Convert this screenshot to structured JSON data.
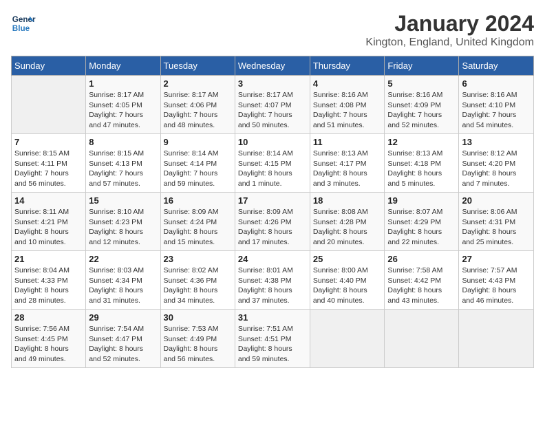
{
  "header": {
    "logo_line1": "General",
    "logo_line2": "Blue",
    "title": "January 2024",
    "subtitle": "Kington, England, United Kingdom"
  },
  "days_of_week": [
    "Sunday",
    "Monday",
    "Tuesday",
    "Wednesday",
    "Thursday",
    "Friday",
    "Saturday"
  ],
  "weeks": [
    [
      {
        "day": "",
        "info": ""
      },
      {
        "day": "1",
        "info": "Sunrise: 8:17 AM\nSunset: 4:05 PM\nDaylight: 7 hours\nand 47 minutes."
      },
      {
        "day": "2",
        "info": "Sunrise: 8:17 AM\nSunset: 4:06 PM\nDaylight: 7 hours\nand 48 minutes."
      },
      {
        "day": "3",
        "info": "Sunrise: 8:17 AM\nSunset: 4:07 PM\nDaylight: 7 hours\nand 50 minutes."
      },
      {
        "day": "4",
        "info": "Sunrise: 8:16 AM\nSunset: 4:08 PM\nDaylight: 7 hours\nand 51 minutes."
      },
      {
        "day": "5",
        "info": "Sunrise: 8:16 AM\nSunset: 4:09 PM\nDaylight: 7 hours\nand 52 minutes."
      },
      {
        "day": "6",
        "info": "Sunrise: 8:16 AM\nSunset: 4:10 PM\nDaylight: 7 hours\nand 54 minutes."
      }
    ],
    [
      {
        "day": "7",
        "info": "Sunrise: 8:15 AM\nSunset: 4:11 PM\nDaylight: 7 hours\nand 56 minutes."
      },
      {
        "day": "8",
        "info": "Sunrise: 8:15 AM\nSunset: 4:13 PM\nDaylight: 7 hours\nand 57 minutes."
      },
      {
        "day": "9",
        "info": "Sunrise: 8:14 AM\nSunset: 4:14 PM\nDaylight: 7 hours\nand 59 minutes."
      },
      {
        "day": "10",
        "info": "Sunrise: 8:14 AM\nSunset: 4:15 PM\nDaylight: 8 hours\nand 1 minute."
      },
      {
        "day": "11",
        "info": "Sunrise: 8:13 AM\nSunset: 4:17 PM\nDaylight: 8 hours\nand 3 minutes."
      },
      {
        "day": "12",
        "info": "Sunrise: 8:13 AM\nSunset: 4:18 PM\nDaylight: 8 hours\nand 5 minutes."
      },
      {
        "day": "13",
        "info": "Sunrise: 8:12 AM\nSunset: 4:20 PM\nDaylight: 8 hours\nand 7 minutes."
      }
    ],
    [
      {
        "day": "14",
        "info": "Sunrise: 8:11 AM\nSunset: 4:21 PM\nDaylight: 8 hours\nand 10 minutes."
      },
      {
        "day": "15",
        "info": "Sunrise: 8:10 AM\nSunset: 4:23 PM\nDaylight: 8 hours\nand 12 minutes."
      },
      {
        "day": "16",
        "info": "Sunrise: 8:09 AM\nSunset: 4:24 PM\nDaylight: 8 hours\nand 15 minutes."
      },
      {
        "day": "17",
        "info": "Sunrise: 8:09 AM\nSunset: 4:26 PM\nDaylight: 8 hours\nand 17 minutes."
      },
      {
        "day": "18",
        "info": "Sunrise: 8:08 AM\nSunset: 4:28 PM\nDaylight: 8 hours\nand 20 minutes."
      },
      {
        "day": "19",
        "info": "Sunrise: 8:07 AM\nSunset: 4:29 PM\nDaylight: 8 hours\nand 22 minutes."
      },
      {
        "day": "20",
        "info": "Sunrise: 8:06 AM\nSunset: 4:31 PM\nDaylight: 8 hours\nand 25 minutes."
      }
    ],
    [
      {
        "day": "21",
        "info": "Sunrise: 8:04 AM\nSunset: 4:33 PM\nDaylight: 8 hours\nand 28 minutes."
      },
      {
        "day": "22",
        "info": "Sunrise: 8:03 AM\nSunset: 4:34 PM\nDaylight: 8 hours\nand 31 minutes."
      },
      {
        "day": "23",
        "info": "Sunrise: 8:02 AM\nSunset: 4:36 PM\nDaylight: 8 hours\nand 34 minutes."
      },
      {
        "day": "24",
        "info": "Sunrise: 8:01 AM\nSunset: 4:38 PM\nDaylight: 8 hours\nand 37 minutes."
      },
      {
        "day": "25",
        "info": "Sunrise: 8:00 AM\nSunset: 4:40 PM\nDaylight: 8 hours\nand 40 minutes."
      },
      {
        "day": "26",
        "info": "Sunrise: 7:58 AM\nSunset: 4:42 PM\nDaylight: 8 hours\nand 43 minutes."
      },
      {
        "day": "27",
        "info": "Sunrise: 7:57 AM\nSunset: 4:43 PM\nDaylight: 8 hours\nand 46 minutes."
      }
    ],
    [
      {
        "day": "28",
        "info": "Sunrise: 7:56 AM\nSunset: 4:45 PM\nDaylight: 8 hours\nand 49 minutes."
      },
      {
        "day": "29",
        "info": "Sunrise: 7:54 AM\nSunset: 4:47 PM\nDaylight: 8 hours\nand 52 minutes."
      },
      {
        "day": "30",
        "info": "Sunrise: 7:53 AM\nSunset: 4:49 PM\nDaylight: 8 hours\nand 56 minutes."
      },
      {
        "day": "31",
        "info": "Sunrise: 7:51 AM\nSunset: 4:51 PM\nDaylight: 8 hours\nand 59 minutes."
      },
      {
        "day": "",
        "info": ""
      },
      {
        "day": "",
        "info": ""
      },
      {
        "day": "",
        "info": ""
      }
    ]
  ]
}
